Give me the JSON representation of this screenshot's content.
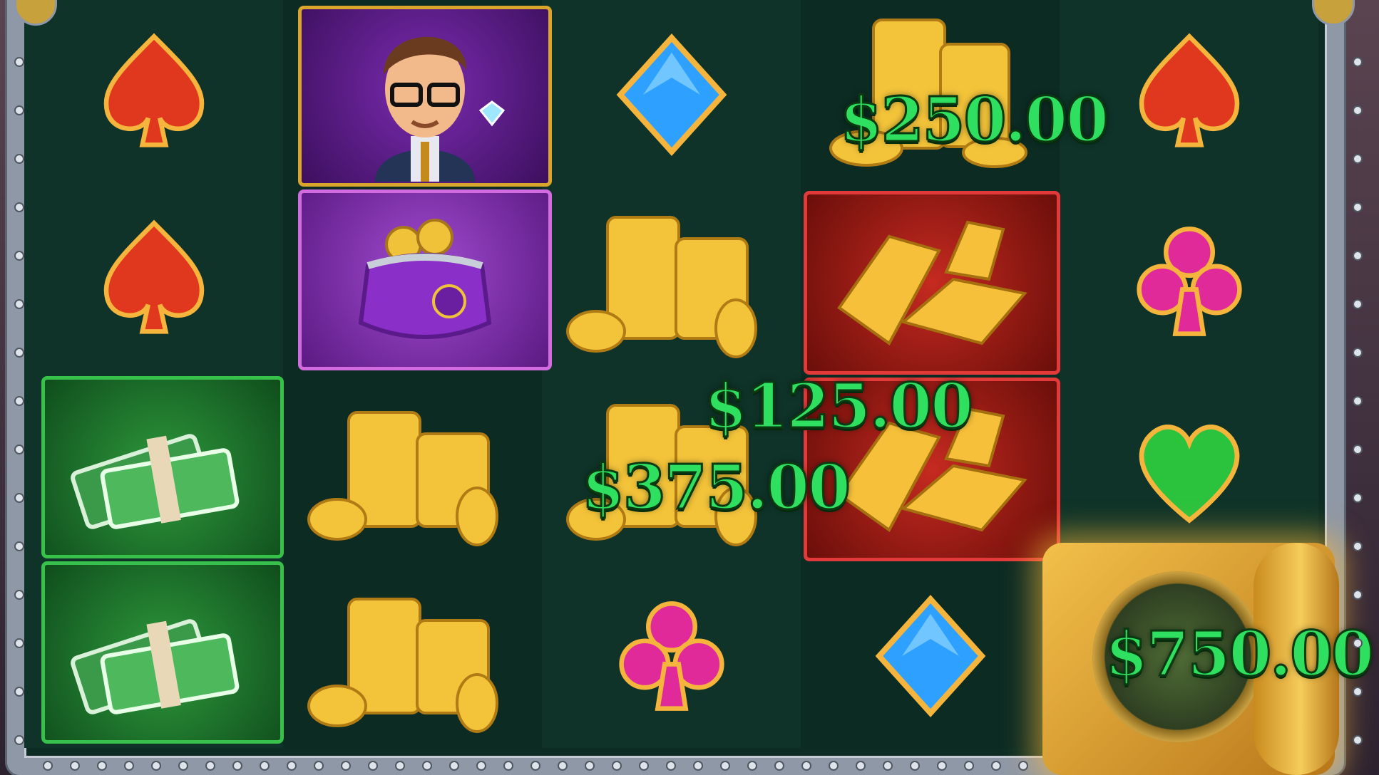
{
  "game": {
    "symbol_grid": [
      [
        "red-spade",
        "red-spade",
        "cash-stack",
        "cash-stack"
      ],
      [
        "character-man-with-diamond",
        "purple-purse",
        "gold-coins",
        "gold-coins"
      ],
      [
        "blue-diamond",
        "gold-coins",
        "gold-coins",
        "pink-club"
      ],
      [
        "gold-coins",
        "gold-bars",
        "gold-bars",
        "blue-diamond"
      ],
      [
        "red-spade",
        "pink-club",
        "green-heart",
        "vault"
      ]
    ],
    "win_amounts": {
      "coin_top": "$250.00",
      "coin_mid_upper": "$125.00",
      "coin_mid_lower": "$375.00",
      "vault": "$750.00"
    }
  },
  "colors": {
    "amount_text": "#2fe060",
    "reel_bg": "#0f3328",
    "frame": "#8f98a6"
  }
}
